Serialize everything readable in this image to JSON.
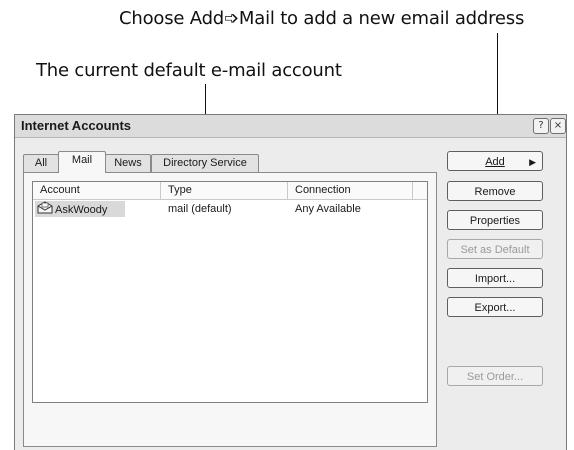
{
  "callouts": {
    "add": "Choose Add➩Mail to add a new email address",
    "default_account": "The current default e-mail account"
  },
  "dialog": {
    "title": "Internet Accounts",
    "help_glyph": "?",
    "close_glyph": "×"
  },
  "tabs": [
    {
      "label": "All"
    },
    {
      "label": "Mail"
    },
    {
      "label": "News"
    },
    {
      "label": "Directory Service"
    }
  ],
  "active_tab": "Mail",
  "list": {
    "columns": [
      "Account",
      "Type",
      "Connection"
    ],
    "rows": [
      {
        "account": "AskWoody",
        "type": "mail (default)",
        "connection": "Any Available"
      }
    ]
  },
  "buttons": {
    "add": "Add",
    "add_arrow": "▶",
    "remove": "Remove",
    "properties": "Properties",
    "set_default": "Set as Default",
    "import": "Import...",
    "export": "Export...",
    "set_order": "Set Order..."
  },
  "icons": {
    "account": "mail-account-icon",
    "help": "help-icon",
    "close": "close-icon",
    "add_arrow": "arrow-right-icon"
  },
  "colors": {
    "dialog_bg": "#ececec",
    "selection": "#d9d9d9",
    "disabled_text": "#9a9a9a"
  }
}
